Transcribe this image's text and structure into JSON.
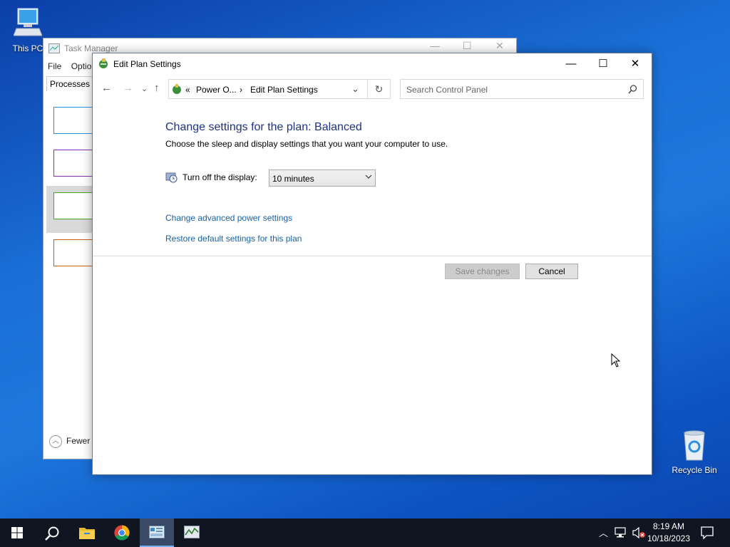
{
  "desktop": {
    "icons": [
      {
        "label": "This PC",
        "icon": "computer-icon"
      },
      {
        "label": "Recycle Bin",
        "icon": "recycle-bin-icon"
      }
    ]
  },
  "task_manager": {
    "title": "Task Manager",
    "menu": [
      "File",
      "Optio"
    ],
    "tab": "Processes",
    "fewer_details": "Fewer"
  },
  "window": {
    "title": "Edit Plan Settings",
    "breadcrumb": {
      "prefix": "«",
      "parent": "Power O...",
      "current": "Edit Plan Settings"
    },
    "search_placeholder": "Search Control Panel",
    "heading": "Change settings for the plan: Balanced",
    "description": "Choose the sleep and display settings that you want your computer to use.",
    "display_setting": {
      "label": "Turn off the display:",
      "value": "10 minutes"
    },
    "links": [
      "Change advanced power settings",
      "Restore default settings for this plan"
    ],
    "buttons": {
      "save": "Save changes",
      "cancel": "Cancel"
    }
  },
  "taskbar": {
    "apps": [
      "start-icon",
      "search-icon",
      "file-explorer-icon",
      "chrome-icon",
      "control-panel-icon",
      "task-manager-icon"
    ],
    "clock": {
      "time": "8:19 AM",
      "date": "10/18/2023"
    }
  },
  "colors": {
    "accent": "#1e3287",
    "link": "#1a62a8",
    "taskbar": "#101522"
  }
}
